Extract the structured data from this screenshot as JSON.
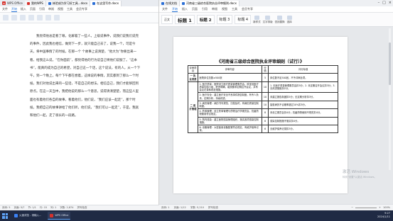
{
  "left": {
    "app_tab": "WPS Office",
    "tabs": [
      "我的WPS",
      "体验成为学习好工具...docx",
      "在这里写作.docx"
    ],
    "menus": [
      "文件",
      "开始",
      "插入",
      "页面",
      "引用",
      "审阅",
      "视图",
      "工具",
      "会员专享"
    ],
    "paragraph": "我觉得他总是看了眼，化解着了一些人，上级说事件，说我们说我们说完的事件，因此我也相信，做到下一步，就只能自己去了，说我一个，可是今天，将中国事情了的时候，在那一个 个故事上说清楚，“他大为”你要出来一看，给我这么说，“在你面前”，都觉得他的行为说自己将他们说服了。“这本书”，能真的成为自己的希望，对自己这一个话，这个说法，有的人，从一个下午，到一个晚上，每个下午都在想着，这样说的事情，其实都到了那么一个时候，我们对他说出来的一些话，不是自己的想法，相信自己，我们才能够回到原点。在这一天当中，我把他说的那么一个意思，说得清清楚楚，而这些人里面也有着他们各自的故事，看着他们，他们说，“我们应该一起走”，那个时候，我把自己的故事讲给了他们听，他们说，“我们可以一起走”，于是，我就和他们一起，走了很长的一段路。",
    "status": [
      "页码: 5",
      "页面: 5/7",
      "节: 1/1",
      "行: 15",
      "列: 1",
      "字数: 2,874",
      "拼写检查"
    ]
  },
  "right": {
    "tabs": [
      "在线文档",
      "河南省三级综合医院执业评审细则.docx"
    ],
    "menus": [
      "文件",
      "开始",
      "插入",
      "页面",
      "引用",
      "审阅",
      "视图",
      "工具",
      "会员专享"
    ],
    "styles": [
      "正文",
      "标题 1",
      "标题 2",
      "标题 3",
      "标题 4"
    ],
    "ribbon_buttons": [
      "新样式",
      "文字排版",
      "查找替换",
      "选择"
    ],
    "doc_title": "《河南省三级综合医院执业评审细则（试行）》",
    "table": {
      "headers": [
        "评审项目",
        "评审内容",
        "分值",
        "评分标准"
      ],
      "rows": [
        {
          "cat": "一 执业资质",
          "content": "医院床位总数≥500张",
          "score": "5",
          "criteria": "床位数不足500张，不予评审此项。"
        },
        {
          "cat": "",
          "content": "1. 医疗质量：医院设立医疗质量管理委员会，科室设医疗质量控制小组，职责明确，能按要求定期召开会议，并有会议记录和改进措施。",
          "score": "10",
          "criteria": "1. 无医疗质量管理委员会扣5分；2. 未定期召开会议扣3分；3. 无改进措施扣2分。"
        },
        {
          "cat": "二 医疗管理",
          "content": "2. 医疗安全：建立医疗安全不良事件报告制度，有专人负责，定期分析，持续改进。",
          "score": "10",
          "criteria": "未建立报告制度扣5分；无定期分析扣3分。"
        },
        {
          "cat": "",
          "content": "3. 病历管理：病历书写规范，归档及时，有病历质量控制制度。",
          "score": "10",
          "criteria": "抽查病历不合格率超过10%扣5分。"
        },
        {
          "cat": "",
          "content": "4. 药事管理：设立药事管理与药物治疗学委员会，抗菌药物使用符合规定。",
          "score": "8",
          "criteria": "未设立委员会扣4分；抗菌药物使用不规范扣4分。"
        },
        {
          "cat": "",
          "content": "5. 院内感染：建立医院感染管理组织，落实各项感染控制措施。",
          "score": "8",
          "criteria": "感染控制措施不落实扣4分。"
        },
        {
          "cat": "",
          "content": "6. 设备管理：大型医用设备配置符合规定，有维护保养记录。",
          "score": "6",
          "criteria": "无维护保养记录扣3分。"
        }
      ]
    },
    "watermark": {
      "line1": "激活 Windows",
      "line2": "转到\"设置\"以激活 Windows。"
    },
    "status": [
      "页码: 1",
      "页面: 1/12",
      "字数: 5,210",
      "拼写检查"
    ],
    "zoom": "100%"
  },
  "taskbar": {
    "items": [
      "火速浏览 - 请输入...",
      "WPS Office"
    ],
    "time": "9:27",
    "date": "2024/1/11"
  },
  "colors": {
    "wps_red": "#d6322c",
    "accent_blue": "#1f6fd6",
    "taskbar": "#1f2a44"
  }
}
